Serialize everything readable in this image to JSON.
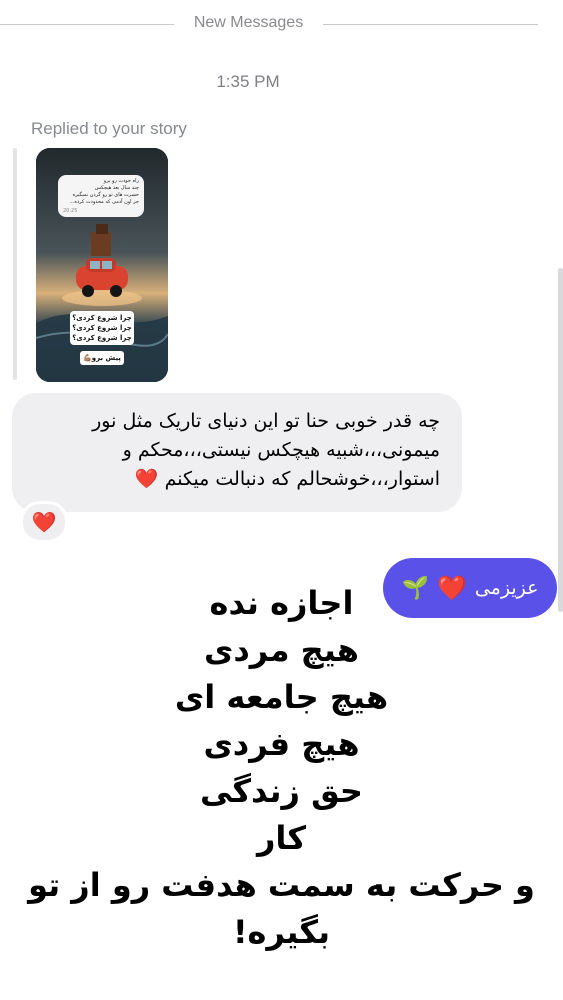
{
  "header": {
    "new_messages_label": "New Messages",
    "timestamp": "1:35 PM"
  },
  "story_reply": {
    "replied_label": "Replied to your story",
    "story": {
      "bubble_lines": [
        "راه خودت رو برو",
        "چند سال بعد هیچکس",
        "حسرت های تو رو گردن نمیگیره",
        "جز اون آدمی که محدودت کرده..."
      ],
      "bubble_time": "20:25",
      "box_lines": [
        "چرا شروع کردی؟",
        "چرا شروع کردی؟",
        "چرا شروع کردی؟"
      ],
      "button_label": "پیش برو💪🏽"
    }
  },
  "incoming_message": {
    "lines": [
      "چه قدر خوبی حنا تو این دنیای تاریک مثل نور",
      "میمونی،،،شبیه هیچکس نیستی،،،محکم و",
      "استوار،،،خوشحالم که دنبالت میکنم"
    ],
    "heart": "❤️",
    "reaction": "❤️"
  },
  "outgoing_message": {
    "text": "عزیزمی",
    "heart": "❤️",
    "sprout": "🌱"
  },
  "caption": {
    "lines": [
      "اجازه نده",
      "هیچ مردی",
      "هیچ جامعه ای",
      "هیچ فردی",
      "حق زندگی",
      "کار",
      "و حرکت به سمت هدفت رو از تو",
      "بگیره!"
    ]
  },
  "colors": {
    "outgoing_bubble": "#5a52e8",
    "incoming_bubble": "#efeff1",
    "heart": "#e8262b"
  }
}
